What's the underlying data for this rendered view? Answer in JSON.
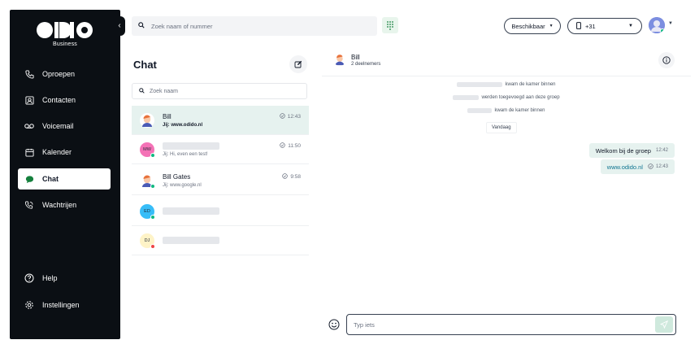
{
  "brand": {
    "subtitle": "Business"
  },
  "sidebar": {
    "items": [
      {
        "label": "Oproepen",
        "icon": "phone-icon"
      },
      {
        "label": "Contacten",
        "icon": "contacts-icon"
      },
      {
        "label": "Voicemail",
        "icon": "voicemail-icon"
      },
      {
        "label": "Kalender",
        "icon": "calendar-icon"
      },
      {
        "label": "Chat",
        "icon": "chat-icon",
        "active": true
      },
      {
        "label": "Wachtrijen",
        "icon": "queue-icon"
      }
    ],
    "bottom": [
      {
        "label": "Help",
        "icon": "help-icon"
      },
      {
        "label": "Instellingen",
        "icon": "settings-icon"
      }
    ]
  },
  "topbar": {
    "search_placeholder": "Zoek naam of nummer",
    "status": "Beschikbaar",
    "phone_prefix": "+31"
  },
  "chatlist": {
    "title": "Chat",
    "search_placeholder": "Zoek naam",
    "items": [
      {
        "name": "Bill",
        "preview": "Jij: www.odido.nl",
        "time": "12:43",
        "avatar_bg": "#ffffff",
        "active": true
      },
      {
        "name": "",
        "initials": "MW",
        "preview": "Jij: Hi, even een test!",
        "time": "11:50",
        "avatar_bg": "#f472b6",
        "status": "#10b981"
      },
      {
        "name": "Bill Gates",
        "preview": "Jij: www.google.nl",
        "time": "9:58",
        "avatar_bg": "#ffffff",
        "status": "#10b981"
      },
      {
        "name": "",
        "initials": "ED",
        "preview": "",
        "time": "",
        "avatar_bg": "#38bdf8",
        "status": "#10b981"
      },
      {
        "name": "",
        "initials": "DJ",
        "preview": "",
        "time": "",
        "avatar_bg": "#fef3c7",
        "status": "#ef4444"
      }
    ]
  },
  "conversation": {
    "name": "Bill",
    "participants": "2 deelnemers",
    "system": [
      "kwam de kamer binnen",
      "werden toegevoegd aan deze groep",
      "kwam de kamer binnen"
    ],
    "date_chip": "Vandaag",
    "messages": [
      {
        "text": "Welkom bij de groep",
        "time": "12:42"
      },
      {
        "text": "www.odido.nl",
        "time": "12:43",
        "link": true
      }
    ],
    "input_placeholder": "Typ iets"
  },
  "colors": {
    "accent": "#e6f2ef",
    "sidebar": "#0b0f14",
    "online": "#10b981",
    "offline": "#ef4444"
  }
}
